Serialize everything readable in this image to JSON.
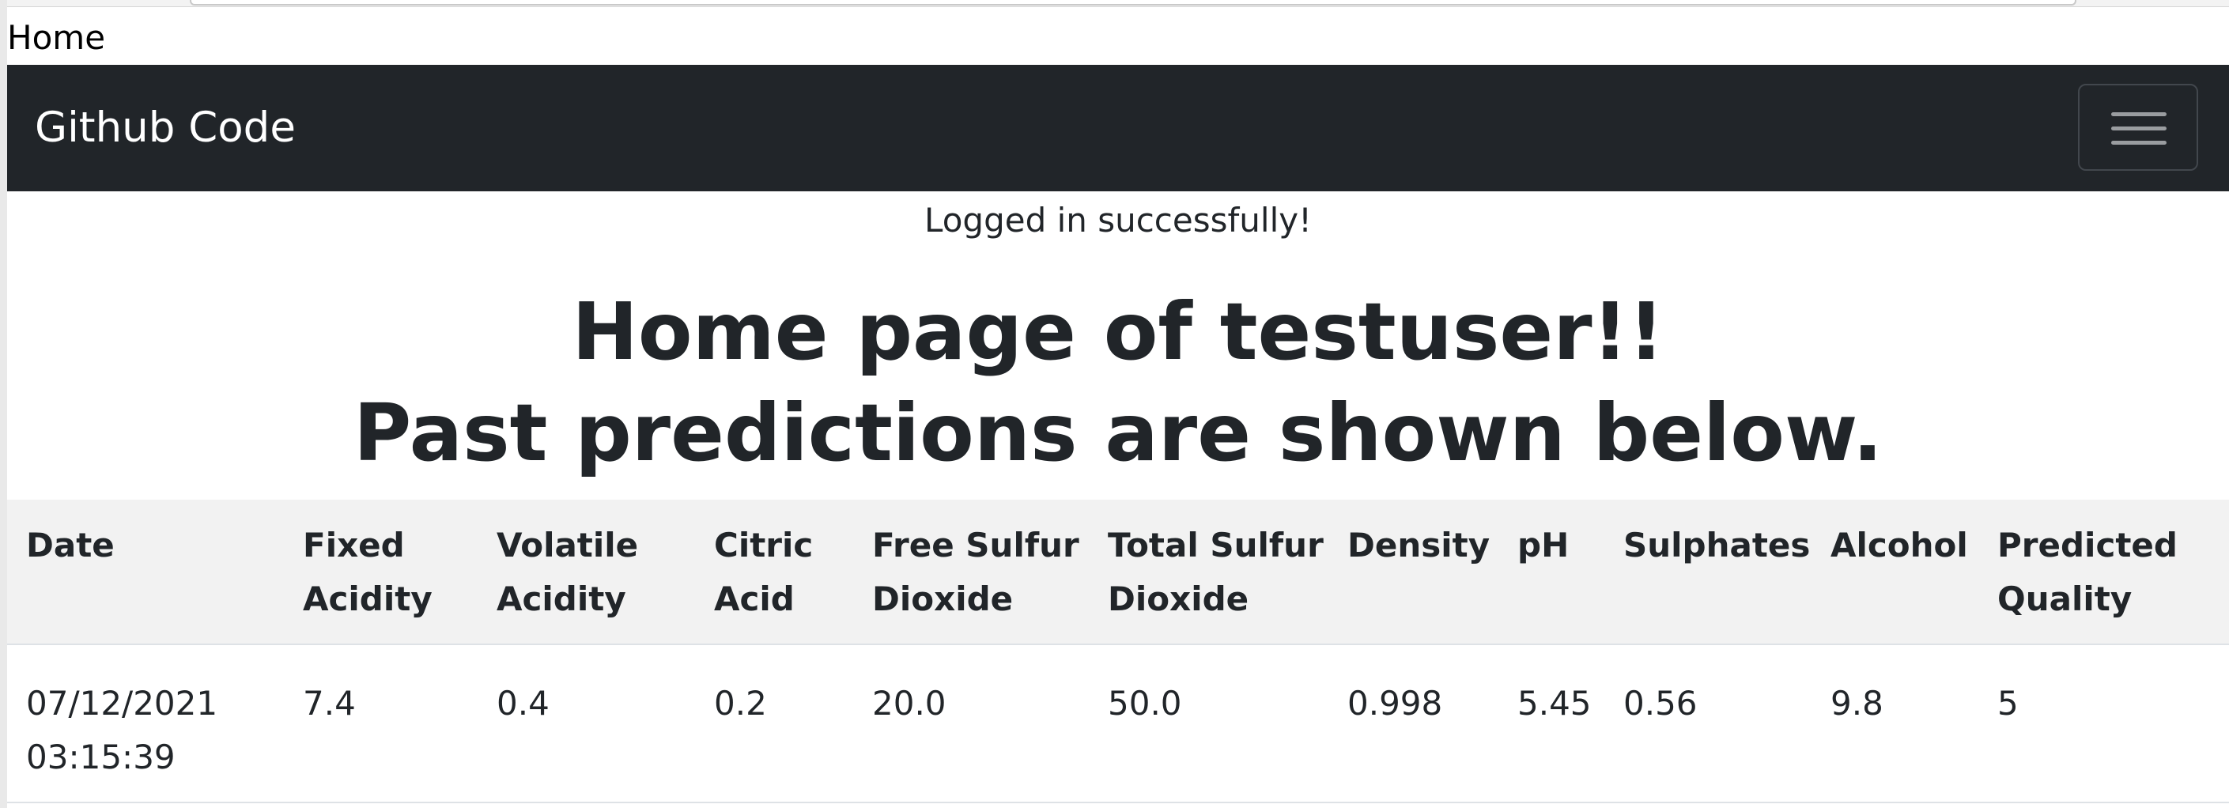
{
  "browser": {
    "tab_title": "Home"
  },
  "navbar": {
    "brand": "Github Code"
  },
  "flash_message": "Logged in successfully!",
  "heading": {
    "line1": "Home page of testuser!!",
    "line2": "Past predictions are shown below."
  },
  "table": {
    "headers": [
      {
        "l1": "Date",
        "l2": ""
      },
      {
        "l1": "Fixed",
        "l2": "Acidity"
      },
      {
        "l1": "Volatile",
        "l2": "Acidity"
      },
      {
        "l1": "Citric",
        "l2": "Acid"
      },
      {
        "l1": "Free Sulfur",
        "l2": "Dioxide"
      },
      {
        "l1": "Total Sulfur",
        "l2": "Dioxide"
      },
      {
        "l1": "Density",
        "l2": ""
      },
      {
        "l1": "pH",
        "l2": ""
      },
      {
        "l1": "Sulphates",
        "l2": ""
      },
      {
        "l1": "Alcohol",
        "l2": ""
      },
      {
        "l1": "Predicted",
        "l2": "Quality"
      }
    ],
    "rows": [
      {
        "date": "07/12/2021",
        "time": "03:15:39",
        "fixed_acidity": "7.4",
        "volatile_acidity": "0.4",
        "citric_acid": "0.2",
        "free_sulfur_dioxide": "20.0",
        "total_sulfur_dioxide": "50.0",
        "density": "0.998",
        "ph": "5.45",
        "sulphates": "0.56",
        "alcohol": "9.8",
        "predicted_quality": "5"
      }
    ]
  },
  "colors": {
    "navbar_bg": "#212529",
    "header_row_bg": "#f2f2f2",
    "text": "#212529"
  },
  "icons": {
    "navbar_toggler": "hamburger-menu-icon"
  }
}
